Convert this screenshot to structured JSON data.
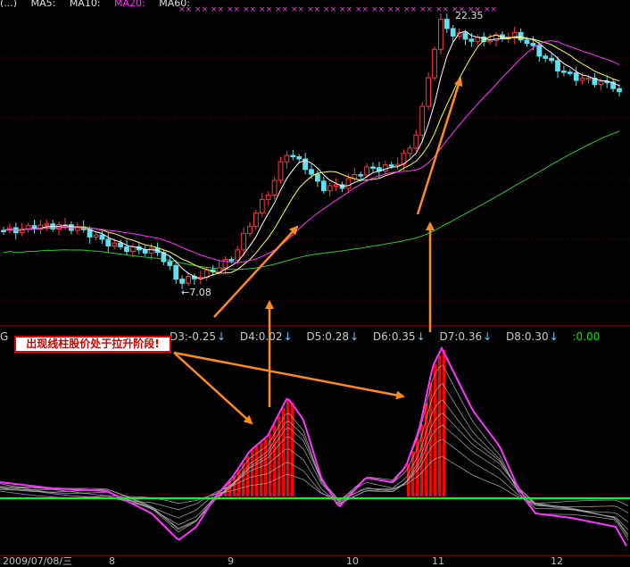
{
  "chart_data": [
    {
      "type": "candlestick",
      "legend": [
        {
          "label": "(...)",
          "color": "#e0e0e0"
        },
        {
          "label": "MA5:",
          "color": "#e0e0e0"
        },
        {
          "label": "MA10:",
          "color": "#e0e0e0"
        },
        {
          "label": "MA20:",
          "color": "#ff33ff"
        },
        {
          "label": "MA60:",
          "color": "#e0e0e0"
        }
      ],
      "annotations": {
        "high": "22.35",
        "low": "7.08"
      },
      "series": [
        {
          "name": "MA5",
          "color": "#ffffff"
        },
        {
          "name": "MA10",
          "color": "#ffff44"
        },
        {
          "name": "MA20",
          "color": "#ff33ff"
        },
        {
          "name": "MA60",
          "color": "#2ec82e"
        }
      ],
      "up_color": "#ff3a3a",
      "down_color": "#5ee0ee"
    },
    {
      "type": "indicator",
      "indicator_values": [
        {
          "label": "D3:-0.25"
        },
        {
          "label": "D4:0.02"
        },
        {
          "label": "D5:0.28"
        },
        {
          "label": "D6:0.35"
        },
        {
          "label": "D7:0.36"
        },
        {
          "label": "D8:0.30"
        }
      ],
      "tail": ":0.00",
      "indicator_prefix": "G",
      "main_line_color": "#ff33ff",
      "bar_color": "#ff0000",
      "zero_line_color": "#00ff00"
    }
  ],
  "callout": {
    "text": "出现线柱股价处于拉升阶段!",
    "text_color": "#d00000",
    "border_color": "#e00000"
  },
  "arrow_color": "#ff8a1e",
  "x_axis": {
    "first_date": "2009/07/08/三",
    "months": [
      "8",
      "9",
      "10",
      "11",
      "12"
    ]
  }
}
